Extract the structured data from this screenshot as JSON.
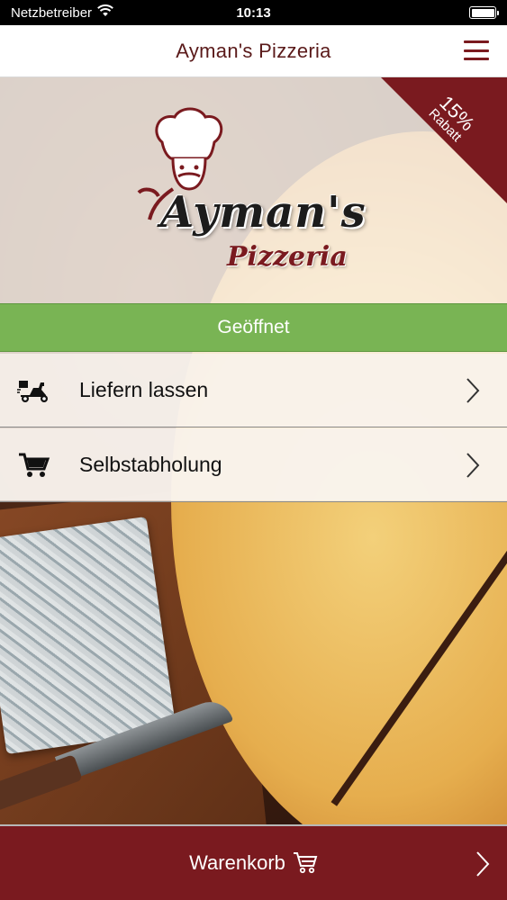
{
  "status_bar": {
    "carrier": "Netzbetreiber",
    "time": "10:13",
    "wifi_icon": "wifi-icon",
    "battery_icon": "battery-icon",
    "battery_level": 1.0
  },
  "nav": {
    "title": "Ayman's Pizzeria",
    "menu_icon": "hamburger-menu-icon"
  },
  "logo": {
    "name": "Ayman's",
    "subtitle": "Pizzeria"
  },
  "discount": {
    "percent": "15%",
    "label": "Rabatt"
  },
  "open_status": {
    "label": "Geöffnet",
    "color": "#79b454"
  },
  "options": [
    {
      "label": "Liefern lassen",
      "icon": "delivery-scooter-icon"
    },
    {
      "label": "Selbstabholung",
      "icon": "shopping-cart-icon"
    }
  ],
  "cart": {
    "label": "Warenkorb",
    "icon": "cart-icon",
    "color": "#7a1a1f"
  },
  "colors": {
    "brand": "#7a1a1f",
    "title_text": "#5a1a1a"
  }
}
